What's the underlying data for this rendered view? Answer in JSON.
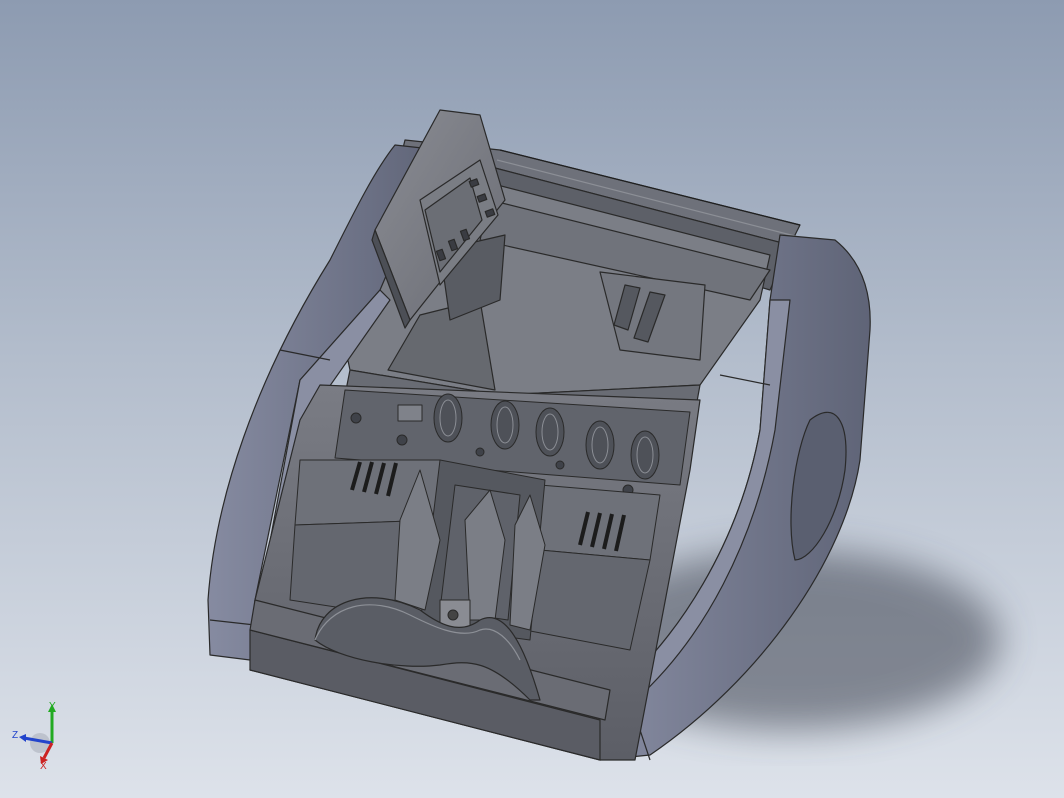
{
  "viewport": {
    "background_top": "#8d9bb1",
    "background_bottom": "#dde2ea"
  },
  "model": {
    "body_color": "#6b6e77",
    "side_shell_color": "#767b92",
    "edge_color": "#2a2a2a"
  },
  "triad": {
    "x_label": "X",
    "y_label": "Y",
    "z_label": "Z",
    "x_color": "#cc2222",
    "y_color": "#22aa22",
    "z_color": "#2244cc"
  }
}
